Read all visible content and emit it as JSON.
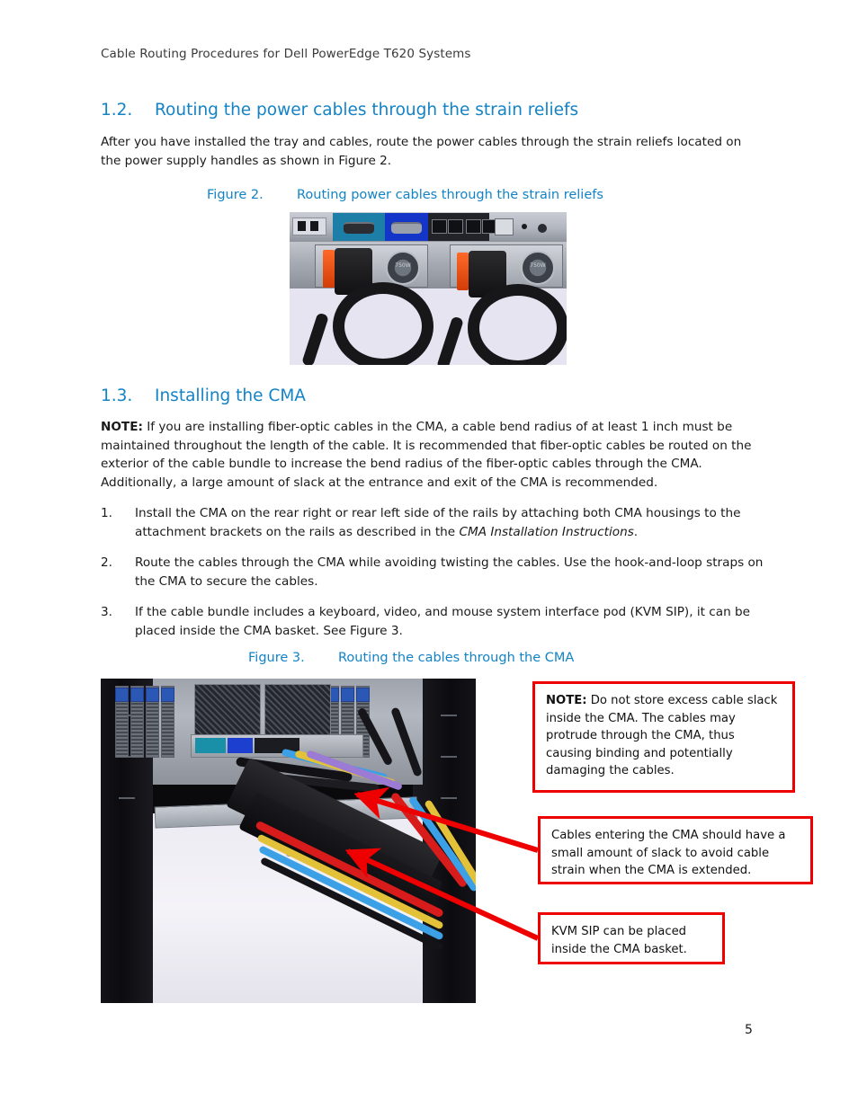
{
  "document": {
    "running_header": "Cable Routing Procedures for Dell PowerEdge T620 Systems",
    "page_number": "5",
    "accent_blue": "#1383c6",
    "callout_red": "#ee0000"
  },
  "sections": [
    {
      "number": "1.2.",
      "title": "Routing the power cables through the strain reliefs",
      "intro": "After you have installed the tray and cables, route the power cables through the strain reliefs located on the power supply handles as shown in Figure 2."
    },
    {
      "number": "1.3.",
      "title": "Installing the CMA",
      "note_label": "NOTE:",
      "note_body": " If you are installing fiber-optic cables in the CMA, a cable bend radius of at least 1 inch must be maintained throughout the length of the cable.  It is recommended that fiber-optic cables be routed on the exterior of the cable bundle to increase the bend radius of the fiber-optic cables through the CMA. Additionally, a large amount of slack at the entrance and exit of the CMA is recommended."
    }
  ],
  "steps": [
    {
      "marker": "1.",
      "text_before_italic": "Install the CMA on the rear right or rear left side of the rails by attaching both CMA housings to the attachment brackets on the rails as described in the ",
      "italic": "CMA Installation Instructions",
      "text_after_italic": "."
    },
    {
      "marker": "2.",
      "text_before_italic": "Route the cables through the CMA while avoiding twisting the cables.  Use the hook-and-loop straps on the CMA to secure the cables.",
      "italic": "",
      "text_after_italic": ""
    },
    {
      "marker": "3.",
      "text_before_italic": "If the cable bundle includes a keyboard, video, and mouse system interface pod (KVM SIP), it can be placed inside the CMA basket. See Figure 3.",
      "italic": "",
      "text_after_italic": ""
    }
  ],
  "figures": [
    {
      "label": "Figure 2.",
      "title": "Routing power cables through the strain reliefs",
      "alt": "Rear of a Dell PowerEdge server showing two power supplies with power cables routed through orange strain relief handles",
      "psu_rating": "750W"
    },
    {
      "label": "Figure 3.",
      "title": "Routing the cables through the CMA",
      "alt": "Rear view of a rack-mounted server with cables routed through the cable management arm (CMA) resting on a white tray"
    }
  ],
  "callouts": [
    {
      "id": "note-excess-slack",
      "bold_prefix": "NOTE:",
      "text": "  Do not store excess cable slack inside the CMA.  The cables may protrude through the CMA, thus causing binding and potentially damaging the cables."
    },
    {
      "id": "cables-entering-cma",
      "bold_prefix": "",
      "text": "Cables entering the CMA should have a small amount of slack to avoid cable strain when the CMA is extended."
    },
    {
      "id": "kvm-sip-basket",
      "bold_prefix": "",
      "text": "KVM SIP can be placed inside the CMA basket."
    }
  ]
}
